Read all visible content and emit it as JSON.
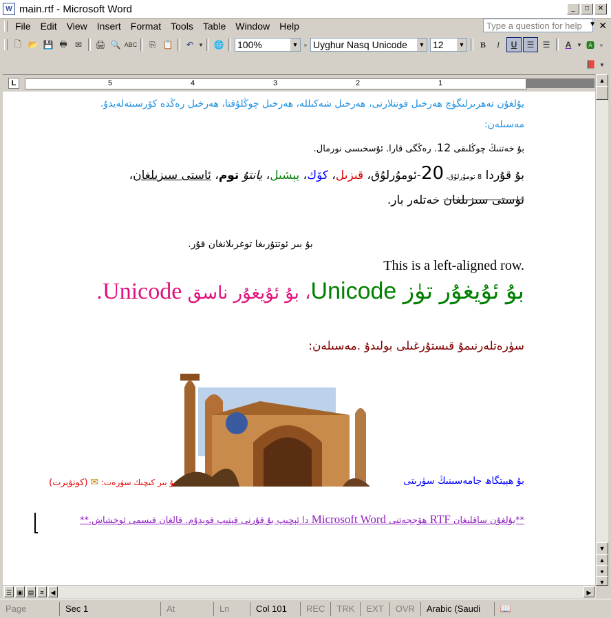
{
  "window": {
    "title": "main.rtf - Microsoft Word",
    "app_icon": "W"
  },
  "menu": [
    "File",
    "Edit",
    "View",
    "Insert",
    "Format",
    "Tools",
    "Table",
    "Window",
    "Help"
  ],
  "help": {
    "placeholder": "Type a question for help"
  },
  "toolbar": {
    "zoom": "100%",
    "font": "Uyghur Nasq Unicode",
    "size": "12",
    "bold": "B",
    "italic": "I",
    "underline": "U"
  },
  "ruler": {
    "numbers": [
      "5",
      "4",
      "3",
      "2",
      "1"
    ]
  },
  "document": {
    "line1": "يۇلغۇن تەھرىرلىگۈچ ھەرخىل فونتلارنى، ھەرخىل شەكىللە، ھەرخىل چوڭلۇقتا، ھەرخىل رەڭدە كۆرسىتەلەيدۇ.",
    "line2": "مەسىلەن:",
    "line3_text": "بۇ خەتنىڭ چوڭلىقى ",
    "line3_num": "12",
    "line3_rest": ". رەڭگى قارا. ئۇسخىسى نورمال.",
    "line4_parts": {
      "a": "بۇ قۇردا ",
      "b": "8",
      "c": " ئوموُرلوُق، ",
      "d": "20",
      "e": "-ئوموُرلوُق، ",
      "red": "قىزىل",
      "comma1": "، ",
      "blue": "كۆك",
      "comma2": "، ",
      "green": "يېشىل",
      "comma3": "، ",
      "italic": "يانتۇ",
      "comma4": " ",
      "bold": "توم",
      "comma5": "، ",
      "underline": "ئاستى سىزىلغان",
      "comma6": "، ",
      "strike": "ئۈستى سىزىلغان",
      "end": " خەتلەر بار."
    },
    "center_line": "بۇ بىر ئوتتۇرىغا توغرىلانغان قۇر.",
    "ltr_line": "This is a left-aligned row.",
    "big_line_green1": "بۇ ئۇيغۇر تۈز ",
    "big_line_green2": "Unicode",
    "big_line_pink1": "، بۇ ئۇيغۇر ناسق ",
    "big_line_pink2": "Unicode",
    "big_line_dot": ".",
    "image_caption": "سۈرەتلەرنىمۇ قىستۇرغىلى بولىدۇ .مەسىلەن:",
    "photo_caption": "بۇ ھېيتگاھ جامەسىنىڭ سۈرىتى",
    "small_pic_text": "بۇ بىر كىچىك سۈرەت:",
    "small_pic_paren": "(كونۋېرت)",
    "footer_note_a": "**يۇلغۇن ساقلىغان ",
    "footer_note_rtf": "RTF",
    "footer_note_b": " ھۆججەتنى ",
    "footer_note_word": "Microsoft Word",
    "footer_note_c": " دا ئېچىپ بۇ قۇرنى قېتىپ قويدۇم. قالغان قىسمى ئوخشاش.**",
    "colors": {
      "blue": "#1e90e0",
      "red": "#e00000",
      "link_blue": "#0000ff",
      "green": "#008000",
      "pink": "#e0107a",
      "purple": "#9020c0",
      "maroon": "#800000"
    }
  },
  "status": {
    "page": "Page",
    "sec": "Sec 1",
    "at": "At",
    "ln": "Ln",
    "col": "Col 101",
    "rec": "REC",
    "trk": "TRK",
    "ext": "EXT",
    "ovr": "OVR",
    "lang": "Arabic (Saudi"
  }
}
